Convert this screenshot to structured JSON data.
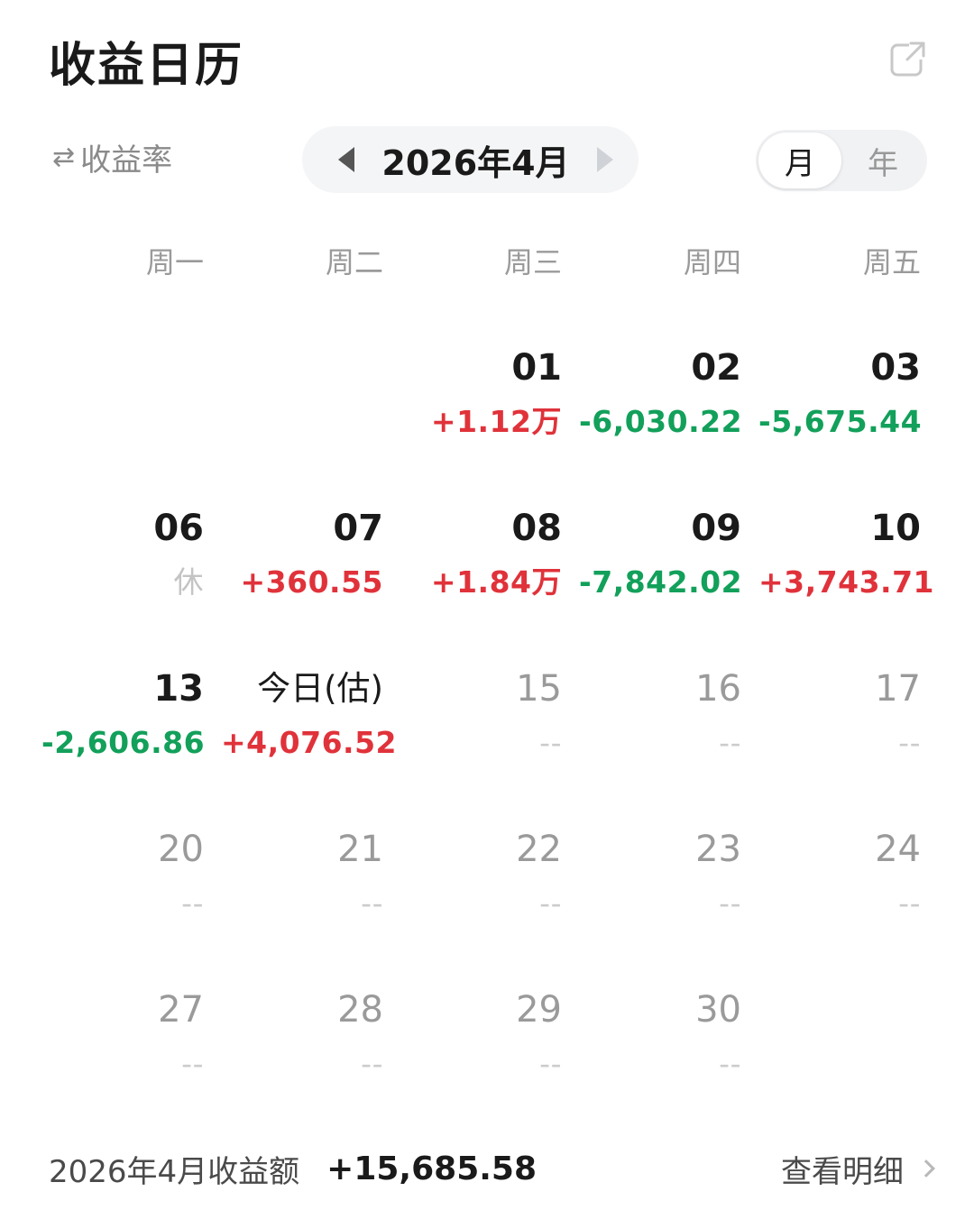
{
  "header": {
    "title": "收益日历",
    "share_icon": "external-link-icon"
  },
  "controls": {
    "rate_toggle_icon": "swap-arrows-icon",
    "rate_toggle_label": "收益率",
    "month_label": "2026年4月",
    "period_options": [
      "月",
      "年"
    ],
    "period_selected": "月"
  },
  "weekdays": [
    "周一",
    "周二",
    "周三",
    "周四",
    "周五"
  ],
  "calendar": {
    "weeks": [
      [
        null,
        null,
        {
          "day": "01",
          "value": "+1.12万",
          "trend": "up"
        },
        {
          "day": "02",
          "value": "-6,030.22",
          "trend": "down"
        },
        {
          "day": "03",
          "value": "-5,675.44",
          "trend": "down"
        }
      ],
      [
        {
          "day": "06",
          "value": "休",
          "trend": "rest"
        },
        {
          "day": "07",
          "value": "+360.55",
          "trend": "up"
        },
        {
          "day": "08",
          "value": "+1.84万",
          "trend": "up"
        },
        {
          "day": "09",
          "value": "-7,842.02",
          "trend": "down"
        },
        {
          "day": "10",
          "value": "+3,743.71",
          "trend": "up"
        }
      ],
      [
        {
          "day": "13",
          "value": "-2,606.86",
          "trend": "down"
        },
        {
          "day": "今日(估)",
          "value": "+4,076.52",
          "trend": "up",
          "today": true
        },
        {
          "day": "15",
          "value": "--",
          "trend": "future"
        },
        {
          "day": "16",
          "value": "--",
          "trend": "future"
        },
        {
          "day": "17",
          "value": "--",
          "trend": "future"
        }
      ],
      [
        {
          "day": "20",
          "value": "--",
          "trend": "future"
        },
        {
          "day": "21",
          "value": "--",
          "trend": "future"
        },
        {
          "day": "22",
          "value": "--",
          "trend": "future"
        },
        {
          "day": "23",
          "value": "--",
          "trend": "future"
        },
        {
          "day": "24",
          "value": "--",
          "trend": "future"
        }
      ],
      [
        {
          "day": "27",
          "value": "--",
          "trend": "future"
        },
        {
          "day": "28",
          "value": "--",
          "trend": "future"
        },
        {
          "day": "29",
          "value": "--",
          "trend": "future"
        },
        {
          "day": "30",
          "value": "--",
          "trend": "future"
        },
        null
      ]
    ]
  },
  "footer": {
    "summary_label": "2026年4月收益额",
    "summary_value": "+15,685.58",
    "detail_label": "查看明细",
    "detail_icon": "chevron-right-icon"
  },
  "colors": {
    "up": "#e0323a",
    "down": "#12a05a",
    "rest": "#c4c4c4",
    "future": "#cccccc"
  }
}
